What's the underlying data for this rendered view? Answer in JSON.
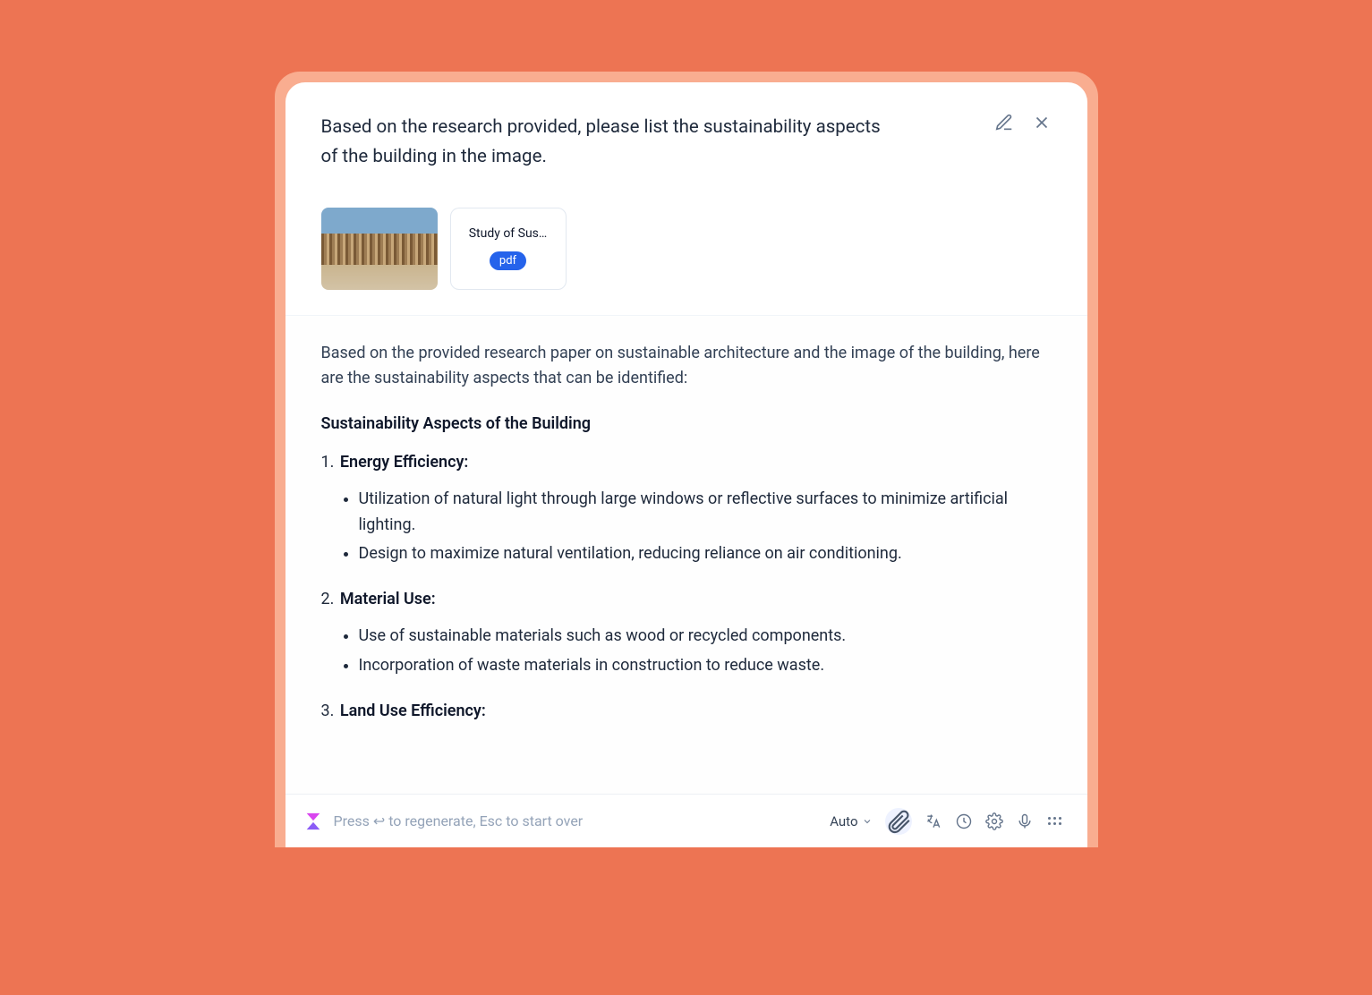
{
  "prompt": "Based on the research provided, please list the sustainability aspects of the building in the image.",
  "attachments": {
    "doc_name": "Study of Sus…",
    "doc_type": "pdf"
  },
  "response": {
    "intro": "Based on the provided research paper on sustainable architecture and the image of the building, here are the sustainability aspects that can be identified:",
    "heading": "Sustainability Aspects of the Building",
    "sections": [
      {
        "num": "1.",
        "title": "Energy Efficiency:",
        "bullets": [
          "Utilization of natural light through large windows or reflective surfaces to minimize artificial lighting.",
          "Design to maximize natural ventilation, reducing reliance on air conditioning."
        ]
      },
      {
        "num": "2.",
        "title": "Material Use:",
        "bullets": [
          "Use of sustainable materials such as wood or recycled components.",
          "Incorporation of waste materials in construction to reduce waste."
        ]
      },
      {
        "num": "3.",
        "title": "Land Use Efficiency:",
        "bullets": []
      }
    ]
  },
  "input": {
    "placeholder": "Press ↩ to regenerate, Esc to start over",
    "mode": "Auto"
  }
}
